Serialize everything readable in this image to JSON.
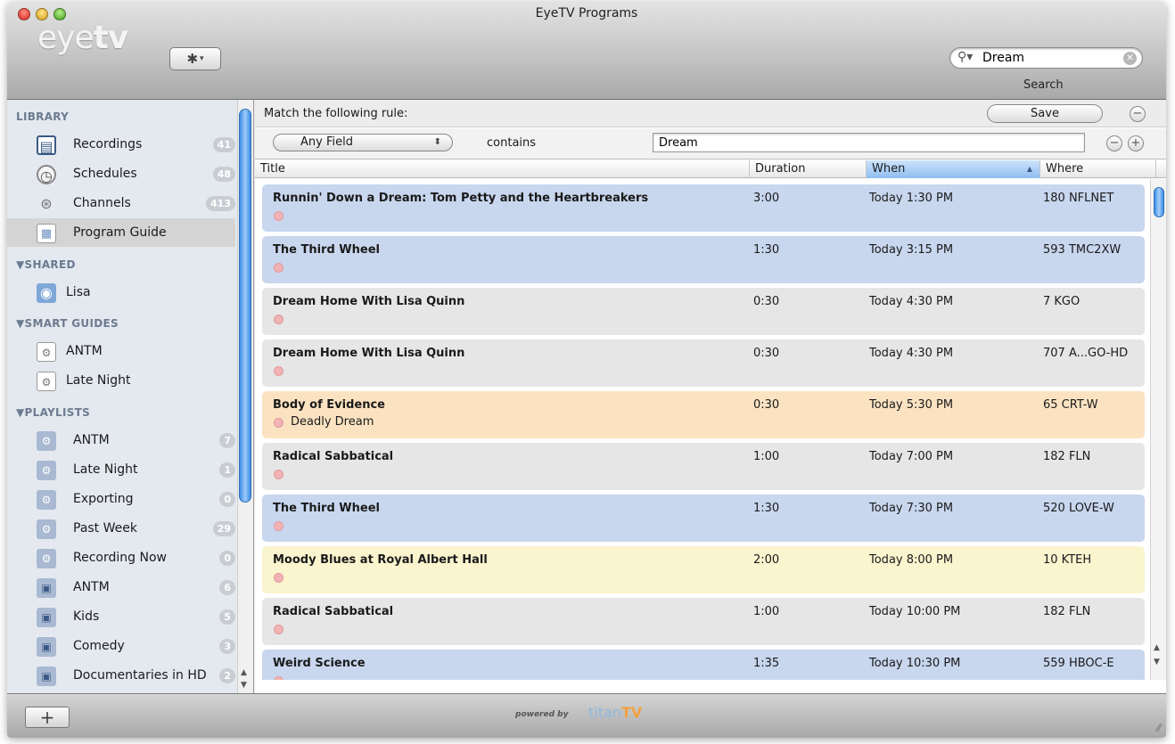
{
  "window": {
    "title": "EyeTV Programs"
  },
  "toolbar": {
    "logo_light": "eye",
    "logo_bold": "tv",
    "gear_label": "✱",
    "search_value": "Dream",
    "search_label": "Search"
  },
  "sidebar": {
    "sections": {
      "library": "LIBRARY",
      "shared": "▼SHARED",
      "smart_guides": "▼SMART GUIDES",
      "playlists": "▼PLAYLISTS"
    },
    "library": [
      {
        "label": "Recordings",
        "badge": "41",
        "icon": "film-icon"
      },
      {
        "label": "Schedules",
        "badge": "48",
        "icon": "clock-icon"
      },
      {
        "label": "Channels",
        "badge": "413",
        "icon": "satellite-icon"
      },
      {
        "label": "Program Guide",
        "badge": "",
        "icon": "guide-icon"
      }
    ],
    "shared": [
      {
        "label": "Lisa",
        "icon": "shared-folder-icon"
      }
    ],
    "smart_guides": [
      {
        "label": "ANTM",
        "icon": "smart-guide-icon"
      },
      {
        "label": "Late Night",
        "icon": "smart-guide-icon"
      }
    ],
    "playlists": [
      {
        "label": "ANTM",
        "badge": "7",
        "icon": "smart-playlist-icon"
      },
      {
        "label": "Late Night",
        "badge": "1",
        "icon": "smart-playlist-icon"
      },
      {
        "label": "Exporting",
        "badge": "0",
        "icon": "smart-playlist-icon"
      },
      {
        "label": "Past Week",
        "badge": "29",
        "icon": "smart-playlist-icon"
      },
      {
        "label": "Recording Now",
        "badge": "0",
        "icon": "smart-playlist-icon"
      },
      {
        "label": "ANTM",
        "badge": "6",
        "icon": "playlist-icon"
      },
      {
        "label": "Kids",
        "badge": "5",
        "icon": "playlist-icon"
      },
      {
        "label": "Comedy",
        "badge": "3",
        "icon": "playlist-icon"
      },
      {
        "label": "Documentaries in HD",
        "badge": "2",
        "icon": "playlist-icon"
      }
    ]
  },
  "rule": {
    "text": "Match the following rule:",
    "save_label": "Save",
    "field": "Any Field",
    "operator": "contains",
    "value": "Dream"
  },
  "columns": {
    "title": "Title",
    "duration": "Duration",
    "when": "When",
    "where": "Where"
  },
  "programs": [
    {
      "title": "Runnin' Down a Dream: Tom Petty and the Heartbreakers",
      "episode": "",
      "duration": "3:00",
      "when": "Today 1:30 PM",
      "where": "180 NFLNET",
      "color": "#c8d6ee"
    },
    {
      "title": "The Third Wheel",
      "episode": "",
      "duration": "1:30",
      "when": "Today 3:15 PM",
      "where": "593 TMC2XW",
      "color": "#c8d6ee"
    },
    {
      "title": "Dream Home With Lisa Quinn",
      "episode": "",
      "duration": "0:30",
      "when": "Today 4:30 PM",
      "where": "7 KGO",
      "color": "#e6e6e6"
    },
    {
      "title": "Dream Home With Lisa Quinn",
      "episode": "",
      "duration": "0:30",
      "when": "Today 4:30 PM",
      "where": "707 A...GO-HD",
      "color": "#e6e6e6"
    },
    {
      "title": "Body of Evidence",
      "episode": "Deadly Dream",
      "duration": "0:30",
      "when": "Today 5:30 PM",
      "where": "65 CRT-W",
      "color": "#fbe3c2"
    },
    {
      "title": "Radical Sabbatical",
      "episode": "",
      "duration": "1:00",
      "when": "Today 7:00 PM",
      "where": "182 FLN",
      "color": "#e6e6e6"
    },
    {
      "title": "The Third Wheel",
      "episode": "",
      "duration": "1:30",
      "when": "Today 7:30 PM",
      "where": "520 LOVE-W",
      "color": "#c8d6ee"
    },
    {
      "title": "Moody Blues at Royal Albert Hall",
      "episode": "",
      "duration": "2:00",
      "when": "Today 8:00 PM",
      "where": "10 KTEH",
      "color": "#faf4cf"
    },
    {
      "title": "Radical Sabbatical",
      "episode": "",
      "duration": "1:00",
      "when": "Today 10:00 PM",
      "where": "182 FLN",
      "color": "#e6e6e6"
    },
    {
      "title": "Weird Science",
      "episode": "",
      "duration": "1:35",
      "when": "Today 10:30 PM",
      "where": "559 HBOC-E",
      "color": "#c8d6ee"
    }
  ],
  "footer": {
    "add_label": "+",
    "powered": "powered by",
    "titan": "titan",
    "titan_tv": "TV"
  }
}
